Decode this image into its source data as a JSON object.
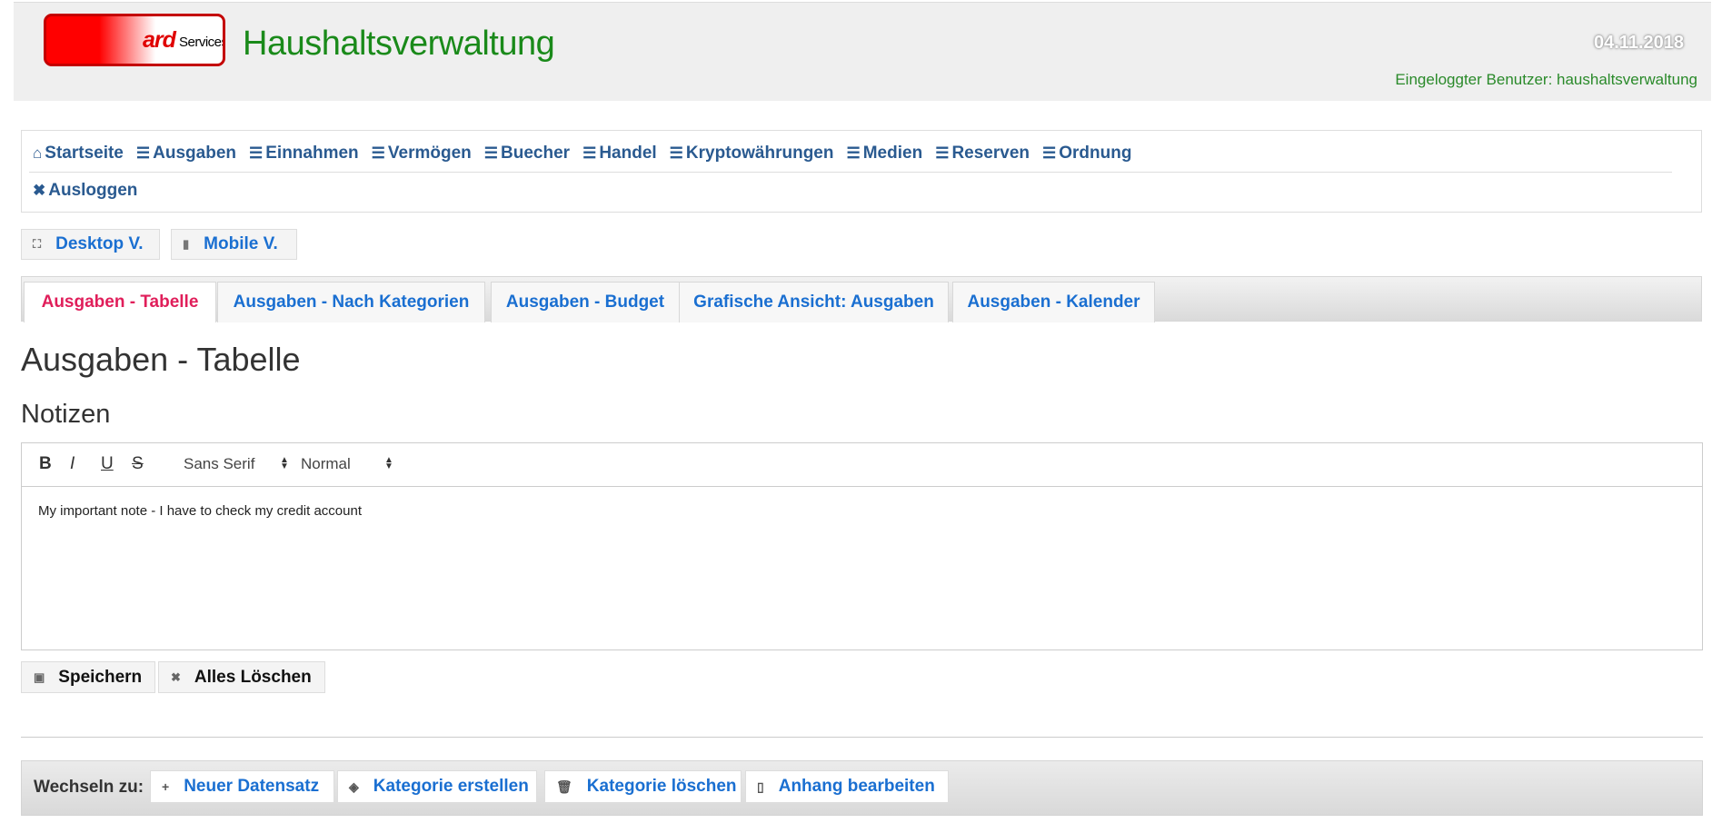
{
  "header": {
    "logo": {
      "brand": "ard",
      "sub": "Services"
    },
    "title": "Haushaltsverwaltung",
    "date": "04.11.2018",
    "user_line": "Eingeloggter Benutzer: haushaltsverwaltung"
  },
  "nav": {
    "items": [
      {
        "label": "Startseite",
        "icon": "home-icon"
      },
      {
        "label": "Ausgaben",
        "icon": "database-icon"
      },
      {
        "label": "Einnahmen",
        "icon": "database-icon"
      },
      {
        "label": "Vermögen",
        "icon": "database-icon"
      },
      {
        "label": "Buecher",
        "icon": "database-icon"
      },
      {
        "label": "Handel",
        "icon": "database-icon"
      },
      {
        "label": "Kryptowährungen",
        "icon": "database-icon"
      },
      {
        "label": "Medien",
        "icon": "database-icon"
      },
      {
        "label": "Reserven",
        "icon": "database-icon"
      },
      {
        "label": "Ordnung",
        "icon": "database-icon"
      }
    ],
    "logout": {
      "label": "Ausloggen",
      "icon": "close-icon"
    }
  },
  "view_buttons": {
    "desktop": {
      "label": "Desktop V.",
      "icon": "fullscreen-icon"
    },
    "mobile": {
      "label": "Mobile V.",
      "icon": "mobile-icon"
    }
  },
  "tabs": [
    {
      "label": "Ausgaben - Tabelle",
      "active": true
    },
    {
      "label": "Ausgaben - Nach Kategorien",
      "active": false
    },
    {
      "label": "Ausgaben - Budget",
      "active": false
    },
    {
      "label": "Grafische Ansicht: Ausgaben",
      "active": false
    },
    {
      "label": "Ausgaben - Kalender",
      "active": false
    }
  ],
  "page_title": "Ausgaben - Tabelle",
  "notes": {
    "heading": "Notizen",
    "toolbar": {
      "bold": "B",
      "italic": "I",
      "underline": "U",
      "strike": "S",
      "font": "Sans Serif",
      "size": "Normal"
    },
    "content": "My important note - I have to check my credit account"
  },
  "actions": {
    "save": {
      "label": "Speichern",
      "icon": "save-icon"
    },
    "clear": {
      "label": "Alles Löschen",
      "icon": "close-icon"
    }
  },
  "footer": {
    "label": "Wechseln zu:",
    "buttons": [
      {
        "label": "Neuer Datensatz",
        "icon": "plus-icon"
      },
      {
        "label": "Kategorie erstellen",
        "icon": "tag-icon"
      },
      {
        "label": "Kategorie löschen",
        "icon": "trash-icon"
      },
      {
        "label": "Anhang bearbeiten",
        "icon": "file-icon"
      }
    ]
  },
  "colors": {
    "title_green": "#1a8a1a",
    "link_blue": "#1a6fd1",
    "nav_blue": "#2a5a90",
    "active_tab": "#e01e5a"
  }
}
